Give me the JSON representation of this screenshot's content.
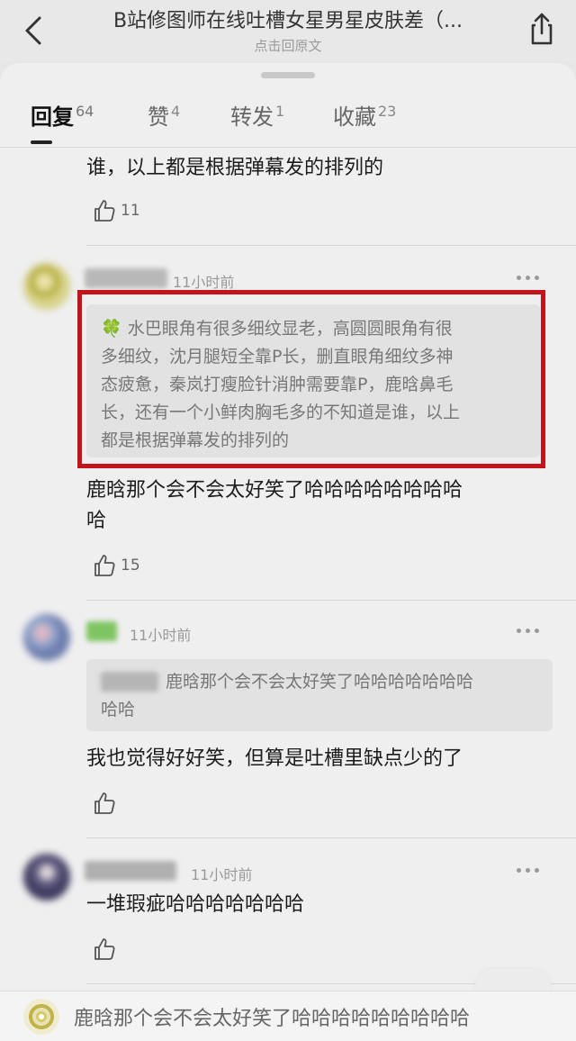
{
  "header": {
    "title": "B站修图师在线吐槽女星男星皮肤差（...",
    "subtitle": "点击回原文"
  },
  "tabs": [
    {
      "label": "回复",
      "count": "64"
    },
    {
      "label": "赞",
      "count": "4"
    },
    {
      "label": "转发",
      "count": "1"
    },
    {
      "label": "收藏",
      "count": "23"
    }
  ],
  "comments": [
    {
      "text": "谁，以上都是根据弹幕发的排列的",
      "likes": "11"
    },
    {
      "time": "11小时前",
      "quote_lines": [
        "🍀 水巴眼角有很多细纹显老，高圆圆眼角有很",
        "多细纹，沈月腿短全靠P长，删直眼角细纹多神",
        "态疲惫，秦岚打瘦脸针消肿需要靠P，鹿晗鼻毛",
        "长，还有一个小鲜肉胸毛多的不知道是谁，以上",
        "都是根据弹幕发的排列的"
      ],
      "text_lines": [
        "鹿晗那个会不会太好笑了哈哈哈哈哈哈哈哈",
        "哈"
      ],
      "likes": "15"
    },
    {
      "time": "11小时前",
      "quote_lines": [
        "鹿晗那个会不会太好笑了哈哈哈哈哈哈哈",
        "哈哈"
      ],
      "text": "我也觉得好好笑，但算是吐槽里缺点少的了",
      "likes": ""
    },
    {
      "time": "11小时前",
      "text": "一堆瑕疵哈哈哈哈哈哈哈",
      "likes": ""
    }
  ],
  "bottom_bar": {
    "text": "鹿晗那个会不会太好笑了哈哈哈哈哈哈哈哈哈"
  },
  "colors": {
    "highlight": "#c4141b"
  }
}
